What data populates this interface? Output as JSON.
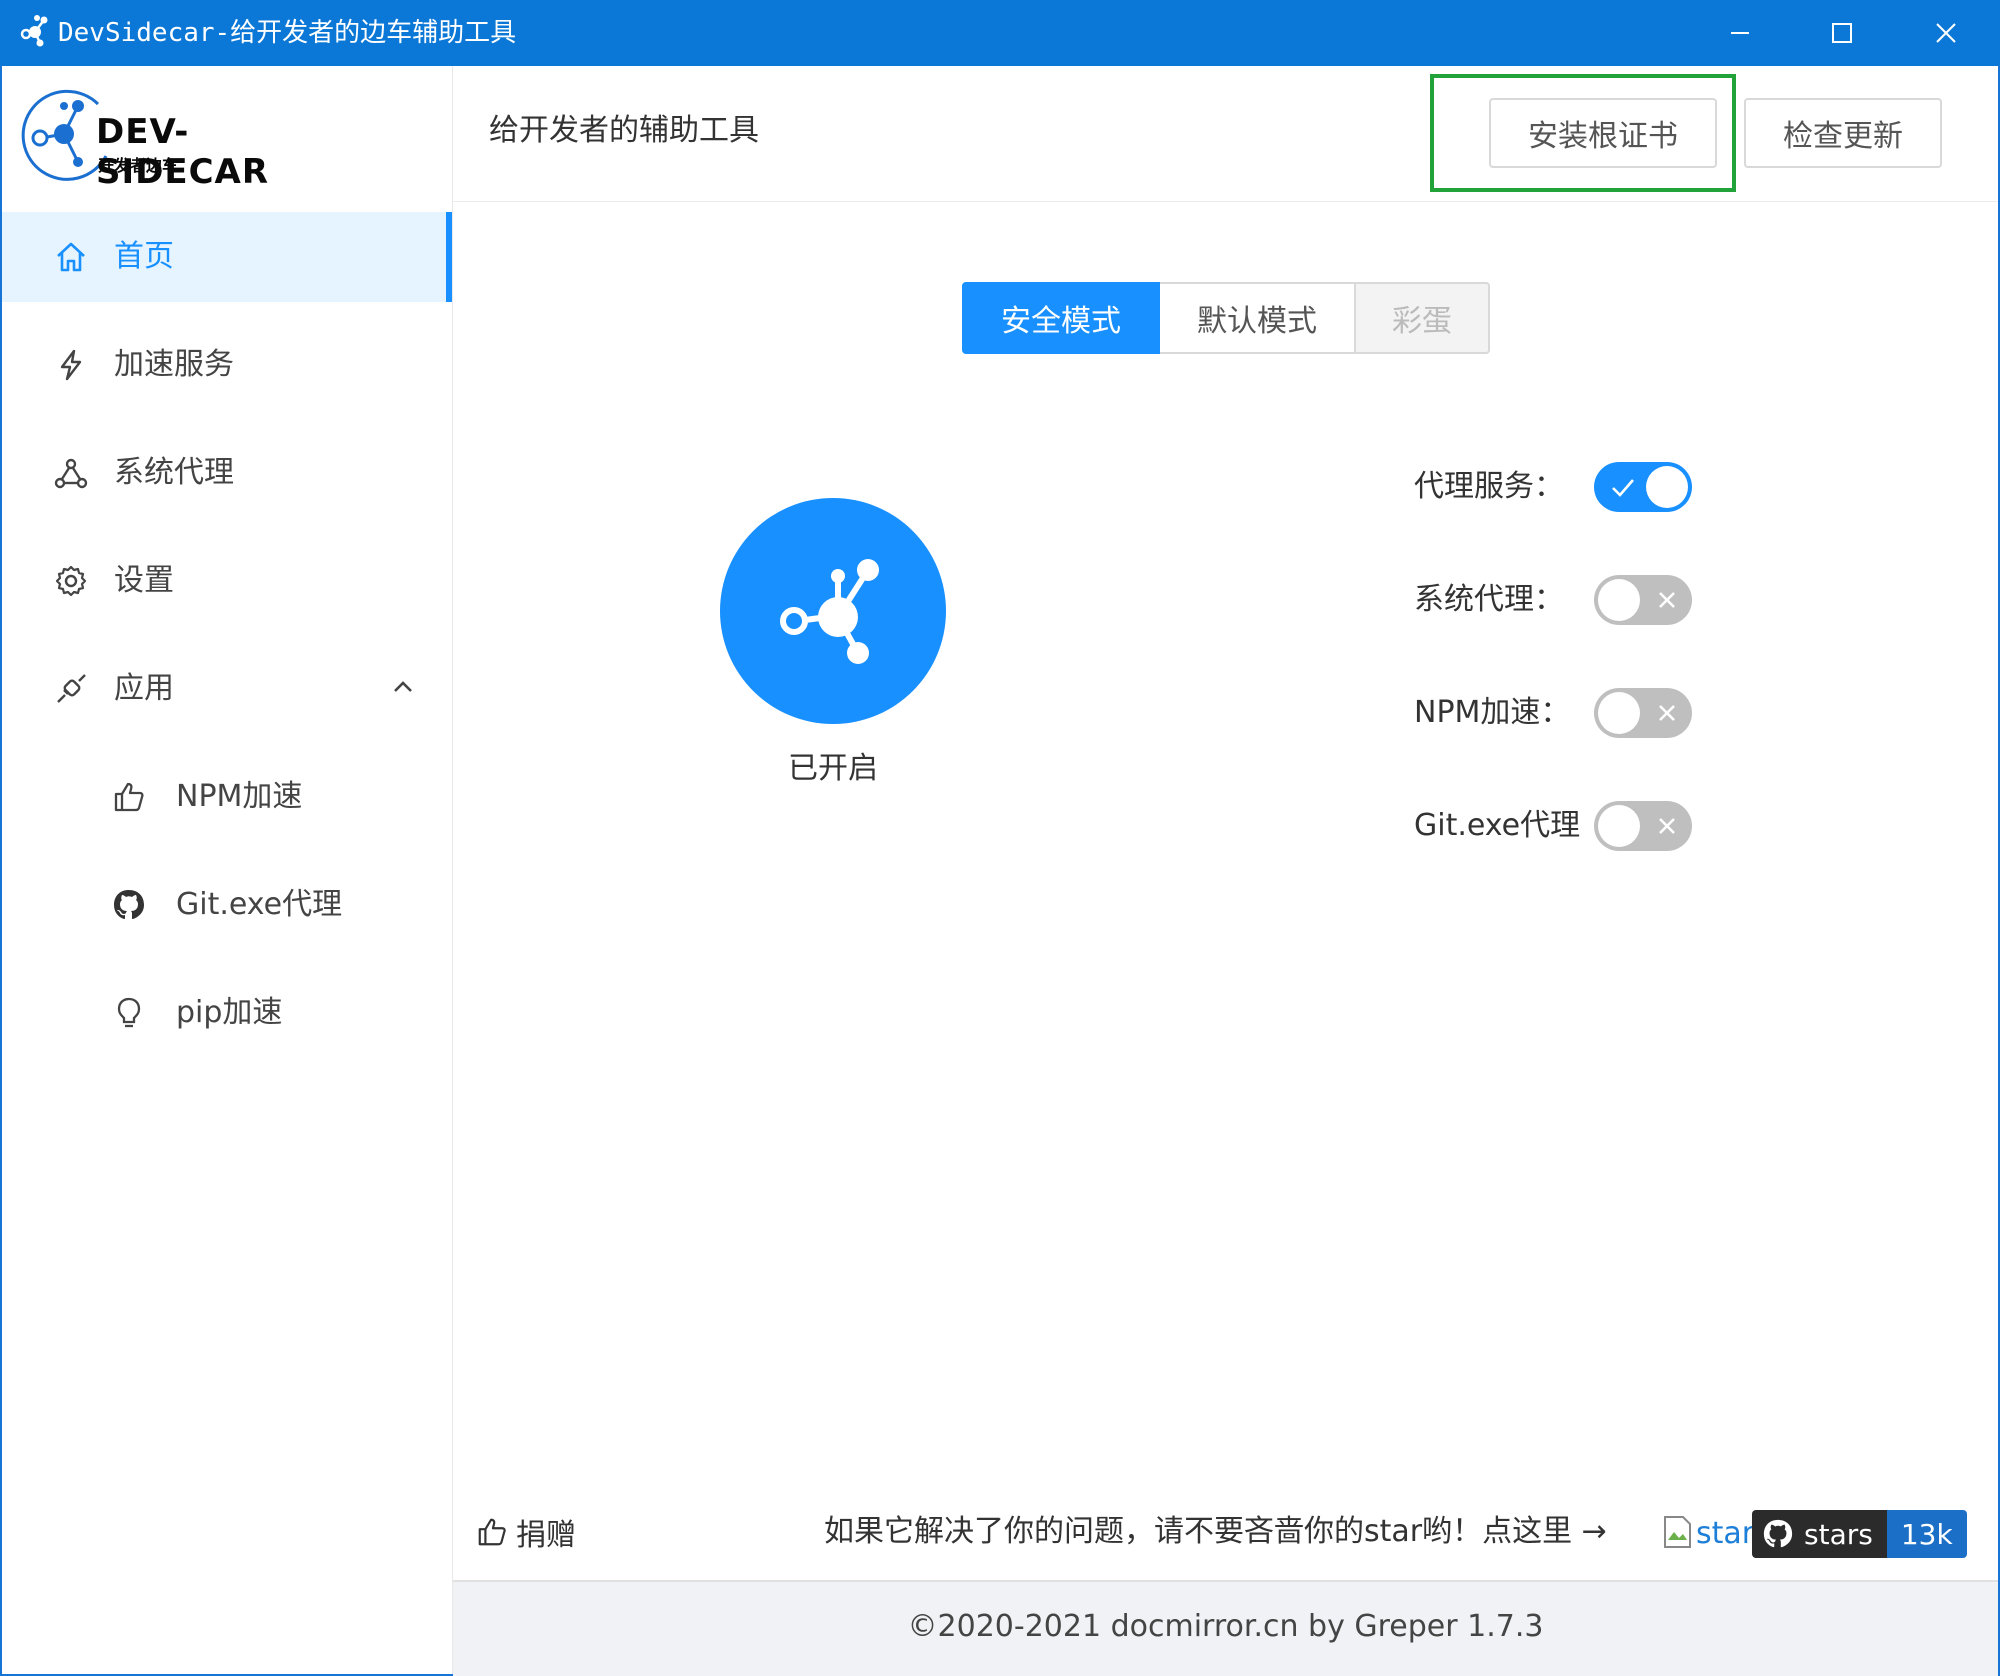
{
  "window": {
    "title": "DevSidecar-给开发者的边车辅助工具",
    "accent": "#0b78d7"
  },
  "logo": {
    "text": "DEV-SIDECAR",
    "subtext": "开发者边车"
  },
  "sidebar": {
    "items": [
      {
        "label": "首页",
        "icon": "home-icon",
        "active": true
      },
      {
        "label": "加速服务",
        "icon": "thunderbolt-icon"
      },
      {
        "label": "系统代理",
        "icon": "share-nodes-icon"
      },
      {
        "label": "设置",
        "icon": "gear-icon"
      },
      {
        "label": "应用",
        "icon": "api-icon",
        "expanded": true
      }
    ],
    "subitems": [
      {
        "label": "NPM加速",
        "icon": "thumbs-up-icon"
      },
      {
        "label": "Git.exe代理",
        "icon": "github-icon"
      },
      {
        "label": "pip加速",
        "icon": "bulb-icon"
      }
    ]
  },
  "header": {
    "subtitle": "给开发者的辅助工具",
    "install_cert": "安装根证书",
    "check_update": "检查更新"
  },
  "modes": {
    "tabs": [
      "安全模式",
      "默认模式",
      "彩蛋"
    ],
    "selected": "安全模式"
  },
  "main_switch": {
    "status": "已开启",
    "color": "#1890ff"
  },
  "switches": [
    {
      "label": "代理服务：",
      "on": true
    },
    {
      "label": "系统代理：",
      "on": false
    },
    {
      "label": "NPM加速：",
      "on": false
    },
    {
      "label": "Git.exe代理",
      "on": false
    }
  ],
  "bottom": {
    "donate": "捐赠",
    "star_prompt": "如果它解决了你的问题，请不要吝啬你的star哟！点这里 →",
    "broken_image_alt": "star",
    "github_label": "stars",
    "github_count": "13k"
  },
  "footer": {
    "copyright": "©2020-2021 docmirror.cn by Greper 1.7.3"
  }
}
